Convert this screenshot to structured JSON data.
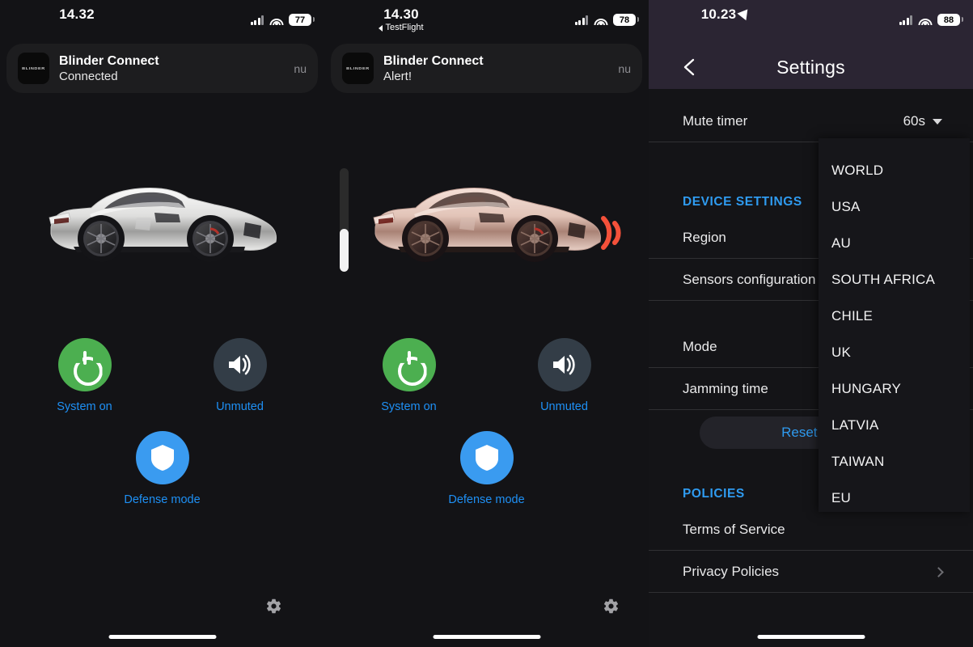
{
  "panels": [
    {
      "id": "panel-connected",
      "status": {
        "time": "14.32",
        "sub": "",
        "battery": "77"
      },
      "notification": {
        "app_icon_text": "BLINDER",
        "title": "Blinder Connect",
        "body": "Connected",
        "meta": "nu"
      },
      "car_state": "idle",
      "controls": [
        {
          "icon": "power-icon",
          "label": "System on",
          "color": "#4caf50"
        },
        {
          "icon": "speaker-on-icon",
          "label": "Unmuted",
          "color": "#333d47"
        }
      ],
      "defense": {
        "icon": "shield-icon",
        "label": "Defense mode",
        "color": "#3a9bf0"
      },
      "gear": "gear-icon"
    },
    {
      "id": "panel-alert",
      "status": {
        "time": "14.30",
        "sub": "TestFlight",
        "battery": "78"
      },
      "notification": {
        "app_icon_text": "BLINDER",
        "title": "Blinder Connect",
        "body": "Alert!",
        "meta": "nu"
      },
      "car_state": "alert",
      "controls": [
        {
          "icon": "power-icon",
          "label": "System on",
          "color": "#4caf50"
        },
        {
          "icon": "speaker-on-icon",
          "label": "Unmuted",
          "color": "#333d47"
        }
      ],
      "defense": {
        "icon": "shield-icon",
        "label": "Defense mode",
        "color": "#3a9bf0"
      },
      "gear": "gear-icon"
    }
  ],
  "settings": {
    "status": {
      "time": "10.23",
      "battery": "88"
    },
    "nav": {
      "back": "back-chevron-icon",
      "title": "Settings"
    },
    "rows": [
      {
        "label": "Mute timer",
        "value": "60s",
        "control": "caret"
      },
      {
        "label": "Region",
        "value": "",
        "control": "none"
      },
      {
        "label": "Sensors configuration",
        "value": "",
        "control": "none"
      },
      {
        "label": "Mode",
        "value": "",
        "control": "none"
      },
      {
        "label": "Jamming time",
        "value": "",
        "control": "none"
      }
    ],
    "sections": {
      "device": "DEVICE SETTINGS",
      "policies": "POLICIES"
    },
    "reset_label": "Reset the",
    "policy_rows": [
      {
        "label": "Terms of Service",
        "control": "none"
      },
      {
        "label": "Privacy Policies",
        "control": "chevron"
      }
    ],
    "region_dropdown": {
      "options": [
        "WORLD",
        "USA",
        "AU",
        "SOUTH AFRICA",
        "CHILE",
        "UK",
        "HUNGARY",
        "LATVIA",
        "TAIWAN",
        "EU"
      ]
    }
  },
  "colors": {
    "accent_blue": "#2f9bf0",
    "power_green": "#4caf50",
    "shield_blue": "#3a9bf0",
    "alert_red": "#f4513a",
    "header_purple": "#2b2533",
    "panel_bg": "#141417"
  },
  "slider": {
    "name": "vertical-scroll-slider",
    "value": 40
  }
}
